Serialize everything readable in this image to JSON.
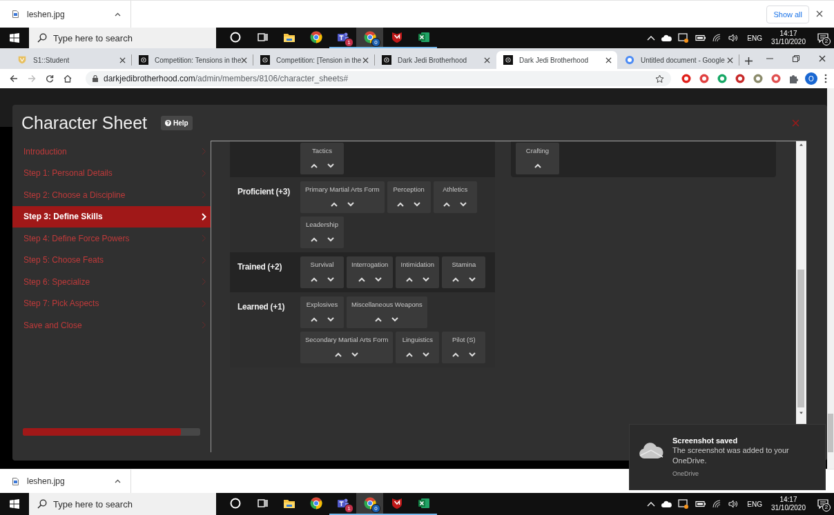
{
  "download_bar_top": {
    "file": "leshen.jpg",
    "show_all": "Show all"
  },
  "taskbar_top": {
    "search_placeholder": "Type here to search",
    "apps": [
      {
        "kind": "cortana",
        "running": false,
        "selected": false
      },
      {
        "kind": "taskview",
        "running": false,
        "selected": false
      },
      {
        "kind": "explorer",
        "running": false,
        "selected": false
      },
      {
        "kind": "chrome",
        "running": false,
        "selected": false
      },
      {
        "kind": "teams",
        "running": true,
        "selected": false,
        "badge": "1"
      },
      {
        "kind": "chrome",
        "running": true,
        "selected": true,
        "badge": "0"
      },
      {
        "kind": "mcafee",
        "running": true,
        "selected": false
      },
      {
        "kind": "excel",
        "running": true,
        "selected": false
      }
    ],
    "language": "ENG",
    "time": "14:17",
    "date": "31/10/2020",
    "notifications": "2"
  },
  "browser": {
    "tabs": [
      {
        "title": "S1::Student",
        "kind": "shield",
        "selected": false
      },
      {
        "title": "Competition: Tensions in the",
        "kind": "emblem",
        "selected": false
      },
      {
        "title": "Competition: [Tension in the",
        "kind": "emblem",
        "selected": false
      },
      {
        "title": "Dark Jedi Brotherhood",
        "kind": "emblem",
        "selected": false
      },
      {
        "title": "Dark Jedi Brotherhood",
        "kind": "emblem",
        "selected": true
      },
      {
        "title": "Untitled document - Google",
        "kind": "docs",
        "selected": false
      }
    ],
    "url_host": "darkjedibrotherhood.com",
    "url_path": "/admin/members/8106/character_sheets#",
    "profile_initial": "O",
    "page": {
      "title": "Character Sheet",
      "help": "Help",
      "steps": [
        {
          "label": "Introduction",
          "selected": false
        },
        {
          "label": "Step 1: Personal Details",
          "selected": false
        },
        {
          "label": "Step 2: Choose a Discipline",
          "selected": false
        },
        {
          "label": "Step 3: Define Skills",
          "selected": true
        },
        {
          "label": "Step 4: Define Force Powers",
          "selected": false
        },
        {
          "label": "Step 5: Choose Feats",
          "selected": false
        },
        {
          "label": "Step 6: Specialize",
          "selected": false
        },
        {
          "label": "Step 7: Pick Aspects",
          "selected": false
        },
        {
          "label": "Save and Close",
          "selected": false
        }
      ],
      "progress": {
        "level": 0.89
      },
      "skill_columns": [
        [
          {
            "skills": [
              {
                "name": "Tactics",
                "can_lower": true
              }
            ]
          },
          {
            "label": "Proficient (+3)",
            "skills": [
              {
                "name": "Primary Martial Arts Form",
                "can_lower": true
              },
              {
                "name": "Perception",
                "can_lower": true
              },
              {
                "name": "Athletics",
                "can_lower": true
              },
              {
                "name": "Leadership",
                "can_lower": true
              }
            ]
          },
          {
            "label": "Trained (+2)",
            "skills": [
              {
                "name": "Survival",
                "can_lower": true
              },
              {
                "name": "Interrogation",
                "can_lower": true
              },
              {
                "name": "Intimidation",
                "can_lower": true
              },
              {
                "name": "Stamina",
                "can_lower": true
              }
            ]
          },
          {
            "label": "Learned (+1)",
            "skills": [
              {
                "name": "Explosives",
                "can_lower": true
              },
              {
                "name": "Miscellaneous Weapons",
                "can_lower": true
              },
              {
                "name": "Secondary Martial Arts Form",
                "can_lower": true
              },
              {
                "name": "Linguistics",
                "can_lower": true
              },
              {
                "name": "Pilot (S)",
                "can_lower": true
              }
            ]
          }
        ],
        [
          {
            "skills": [
              {
                "name": "Crafting",
                "can_lower": false
              }
            ]
          }
        ]
      ]
    }
  },
  "download_bar_bottom": {
    "file": "leshen.jpg"
  },
  "taskbar_bottom": {
    "search_placeholder": "Type here to search",
    "apps": [
      {
        "kind": "cortana",
        "running": false,
        "selected": false
      },
      {
        "kind": "taskview",
        "running": false,
        "selected": false
      },
      {
        "kind": "explorer",
        "running": false,
        "selected": false
      },
      {
        "kind": "chrome",
        "running": false,
        "selected": false
      },
      {
        "kind": "teams",
        "running": true,
        "selected": false,
        "badge": "1"
      },
      {
        "kind": "chrome",
        "running": true,
        "selected": true,
        "badge": "0"
      },
      {
        "kind": "mcafee",
        "running": true,
        "selected": false
      },
      {
        "kind": "excel",
        "running": true,
        "selected": false
      }
    ],
    "language": "ENG",
    "time": "14:17",
    "date": "31/10/2020",
    "notifications": "2"
  },
  "toast": {
    "title": "Screenshot saved",
    "message": "The screenshot was added to your OneDrive.",
    "source": "OneDrive"
  }
}
